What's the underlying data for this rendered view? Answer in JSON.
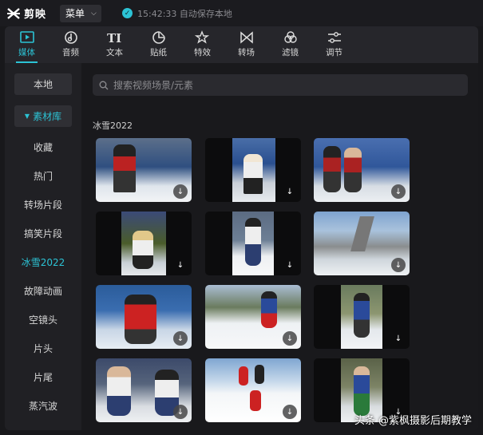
{
  "app": {
    "name": "剪映",
    "menu_label": "菜单",
    "save_status": "15:42:33 自动保存本地"
  },
  "toolbar": [
    {
      "label": "媒体",
      "icon": "media-icon",
      "active": true
    },
    {
      "label": "音频",
      "icon": "audio-icon"
    },
    {
      "label": "文本",
      "icon": "text-icon"
    },
    {
      "label": "贴纸",
      "icon": "sticker-icon"
    },
    {
      "label": "特效",
      "icon": "effects-icon"
    },
    {
      "label": "转场",
      "icon": "transition-icon"
    },
    {
      "label": "滤镜",
      "icon": "filter-icon"
    },
    {
      "label": "调节",
      "icon": "adjust-icon"
    }
  ],
  "sidebar": {
    "local": "本地",
    "library": "素材库",
    "items": [
      "收藏",
      "热门",
      "转场片段",
      "搞笑片段",
      "冰雪2022",
      "故障动画",
      "空镜头",
      "片头",
      "片尾",
      "蒸汽波"
    ],
    "active_item": "冰雪2022"
  },
  "search": {
    "placeholder": "搜索视频场景/元素"
  },
  "section_title": "冰雪2022",
  "watermark": "头条 @紫枫摄影后期教学",
  "colors": {
    "accent": "#2cc3d5"
  }
}
